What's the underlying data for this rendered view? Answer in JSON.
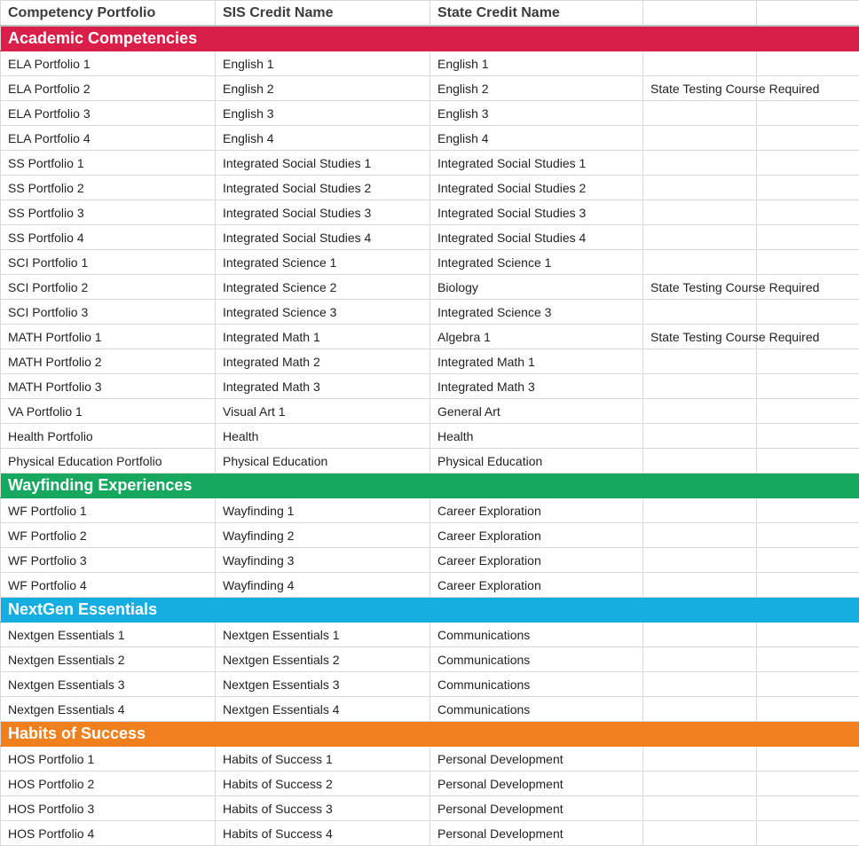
{
  "headers": {
    "col1": "Competency Portfolio",
    "col2": "SIS Credit Name",
    "col3": "State Credit Name",
    "col4": "",
    "col5": ""
  },
  "sections": [
    {
      "title": "Academic Competencies",
      "colorClass": "red",
      "rows": [
        {
          "c1": "ELA Portfolio 1",
          "c2": "English 1",
          "c3": "English 1",
          "c4": "",
          "c5": ""
        },
        {
          "c1": "ELA Portfolio 2",
          "c2": "English 2",
          "c3": "English 2",
          "c4": "State Testing Course Required",
          "c5": ""
        },
        {
          "c1": "ELA Portfolio 3",
          "c2": "English 3",
          "c3": "English 3",
          "c4": "",
          "c5": ""
        },
        {
          "c1": "ELA Portfolio 4",
          "c2": "English 4",
          "c3": "English 4",
          "c4": "",
          "c5": ""
        },
        {
          "c1": "SS Portfolio 1",
          "c2": "Integrated Social Studies 1",
          "c3": "Integrated Social Studies 1",
          "c4": "",
          "c5": ""
        },
        {
          "c1": "SS Portfolio 2",
          "c2": "Integrated Social Studies 2",
          "c3": "Integrated Social Studies 2",
          "c4": "",
          "c5": ""
        },
        {
          "c1": "SS Portfolio 3",
          "c2": "Integrated Social Studies 3",
          "c3": "Integrated Social Studies 3",
          "c4": "",
          "c5": ""
        },
        {
          "c1": "SS Portfolio 4",
          "c2": "Integrated Social Studies 4",
          "c3": "Integrated Social Studies 4",
          "c4": "",
          "c5": ""
        },
        {
          "c1": "SCI Portfolio 1",
          "c2": "Integrated Science 1",
          "c3": "Integrated Science 1",
          "c4": "",
          "c5": ""
        },
        {
          "c1": "SCI Portfolio 2",
          "c2": "Integrated Science 2",
          "c3": "Biology",
          "c4": "State Testing Course Required",
          "c5": ""
        },
        {
          "c1": "SCI Portfolio 3",
          "c2": "Integrated Science 3",
          "c3": "Integrated Science 3",
          "c4": "",
          "c5": ""
        },
        {
          "c1": "MATH Portfolio 1",
          "c2": "Integrated Math 1",
          "c3": "Algebra 1",
          "c4": "State Testing Course Required",
          "c5": ""
        },
        {
          "c1": "MATH Portfolio 2",
          "c2": "Integrated Math 2",
          "c3": "Integrated Math 1",
          "c4": "",
          "c5": ""
        },
        {
          "c1": "MATH Portfolio 3",
          "c2": "Integrated Math 3",
          "c3": "Integrated Math 3",
          "c4": "",
          "c5": ""
        },
        {
          "c1": "VA Portfolio 1",
          "c2": "Visual Art 1",
          "c3": "General Art",
          "c4": "",
          "c5": ""
        },
        {
          "c1": "Health Portfolio",
          "c2": "Health",
          "c3": "Health",
          "c4": "",
          "c5": ""
        },
        {
          "c1": "Physical Education Portfolio",
          "c2": "Physical Education",
          "c3": "Physical Education",
          "c4": "",
          "c5": ""
        }
      ]
    },
    {
      "title": "Wayfinding Experiences",
      "colorClass": "green",
      "rows": [
        {
          "c1": "WF Portfolio 1",
          "c2": "Wayfinding 1",
          "c3": "Career Exploration",
          "c4": "",
          "c5": ""
        },
        {
          "c1": "WF Portfolio 2",
          "c2": "Wayfinding 2",
          "c3": "Career Exploration",
          "c4": "",
          "c5": ""
        },
        {
          "c1": "WF Portfolio 3",
          "c2": "Wayfinding 3",
          "c3": "Career Exploration",
          "c4": "",
          "c5": ""
        },
        {
          "c1": "WF Portfolio 4",
          "c2": "Wayfinding 4",
          "c3": "Career Exploration",
          "c4": "",
          "c5": ""
        }
      ]
    },
    {
      "title": "NextGen Essentials",
      "colorClass": "blue",
      "rows": [
        {
          "c1": "Nextgen Essentials 1",
          "c2": "Nextgen Essentials 1",
          "c3": "Communications",
          "c4": "",
          "c5": ""
        },
        {
          "c1": "Nextgen Essentials 2",
          "c2": "Nextgen Essentials 2",
          "c3": "Communications",
          "c4": "",
          "c5": ""
        },
        {
          "c1": "Nextgen Essentials 3",
          "c2": "Nextgen Essentials 3",
          "c3": "Communications",
          "c4": "",
          "c5": ""
        },
        {
          "c1": "Nextgen Essentials 4",
          "c2": "Nextgen Essentials 4",
          "c3": "Communications",
          "c4": "",
          "c5": ""
        }
      ]
    },
    {
      "title": "Habits of Success",
      "colorClass": "orange",
      "rows": [
        {
          "c1": "HOS Portfolio 1",
          "c2": "Habits of Success 1",
          "c3": "Personal Development",
          "c4": "",
          "c5": ""
        },
        {
          "c1": "HOS Portfolio 2",
          "c2": "Habits of Success 2",
          "c3": "Personal Development",
          "c4": "",
          "c5": ""
        },
        {
          "c1": "HOS Portfolio 3",
          "c2": "Habits of Success 3",
          "c3": "Personal Development",
          "c4": "",
          "c5": ""
        },
        {
          "c1": "HOS Portfolio 4",
          "c2": "Habits of Success 4",
          "c3": "Personal Development",
          "c4": "",
          "c5": ""
        }
      ]
    }
  ]
}
